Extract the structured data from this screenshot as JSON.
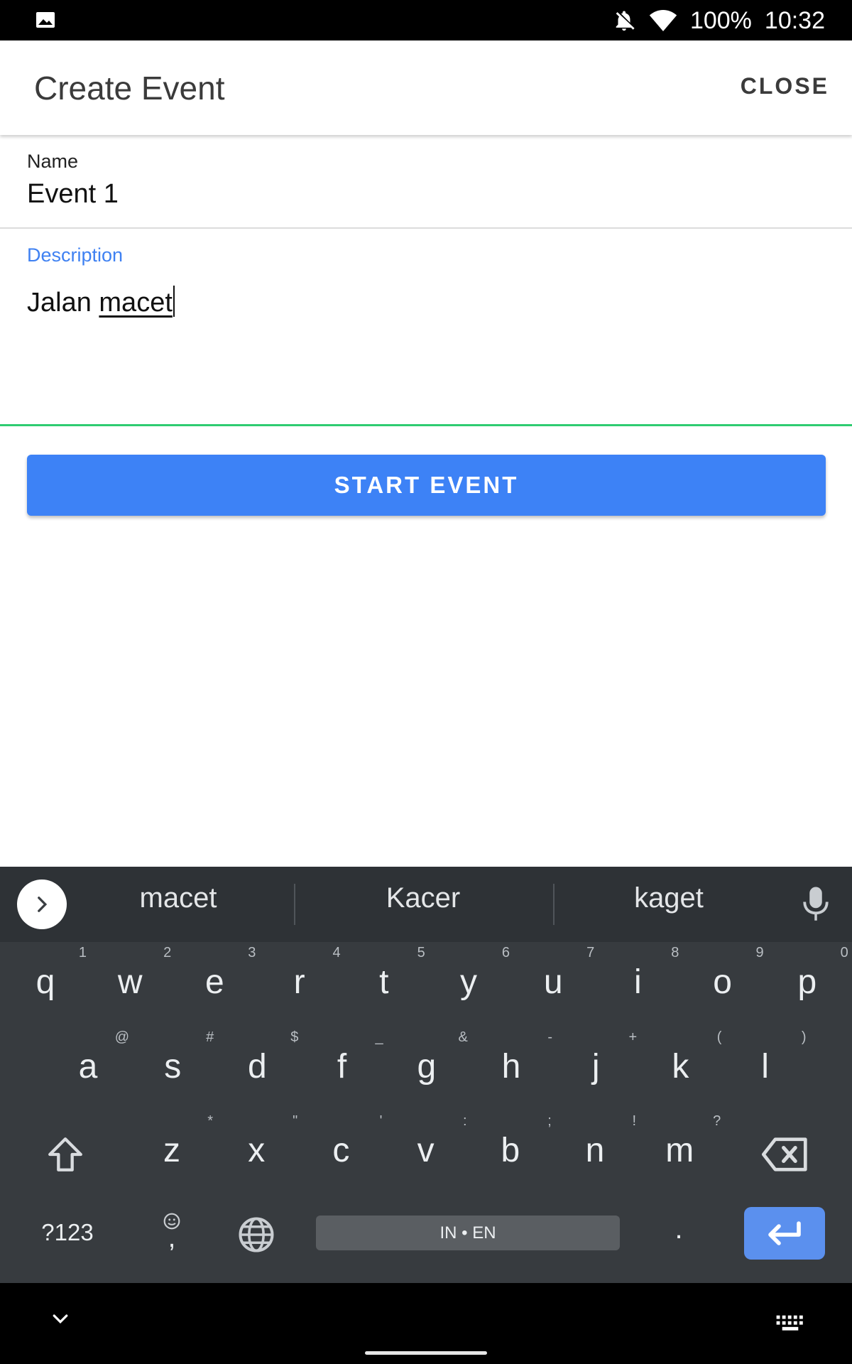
{
  "status_bar": {
    "icons": [
      "image-icon",
      "bell-off-icon",
      "wifi-icon"
    ],
    "battery": "100%",
    "time": "10:32"
  },
  "app_bar": {
    "title": "Create Event",
    "close_label": "CLOSE"
  },
  "form": {
    "name_label": "Name",
    "name_value": "Event 1",
    "description_label": "Description",
    "description_prefix": "Jalan ",
    "description_composing": "macet",
    "description_label_color": "#3f81f2",
    "focus_underline_color": "#2ecc71"
  },
  "start_button": {
    "label": "START EVENT",
    "color": "#3d82f6"
  },
  "keyboard": {
    "suggestions": [
      "macet",
      "Kacer",
      "kaget"
    ],
    "row1": [
      {
        "k": "q",
        "h": "1"
      },
      {
        "k": "w",
        "h": "2"
      },
      {
        "k": "e",
        "h": "3"
      },
      {
        "k": "r",
        "h": "4"
      },
      {
        "k": "t",
        "h": "5"
      },
      {
        "k": "y",
        "h": "6"
      },
      {
        "k": "u",
        "h": "7"
      },
      {
        "k": "i",
        "h": "8"
      },
      {
        "k": "o",
        "h": "9"
      },
      {
        "k": "p",
        "h": "0"
      }
    ],
    "row2": [
      {
        "k": "a",
        "h": "@"
      },
      {
        "k": "s",
        "h": "#"
      },
      {
        "k": "d",
        "h": "$"
      },
      {
        "k": "f",
        "h": "_"
      },
      {
        "k": "g",
        "h": "&"
      },
      {
        "k": "h",
        "h": "-"
      },
      {
        "k": "j",
        "h": "+"
      },
      {
        "k": "k",
        "h": "("
      },
      {
        "k": "l",
        "h": ")"
      }
    ],
    "row3": [
      {
        "k": "z",
        "h": "*"
      },
      {
        "k": "x",
        "h": "\""
      },
      {
        "k": "c",
        "h": "'"
      },
      {
        "k": "v",
        "h": ":"
      },
      {
        "k": "b",
        "h": ";"
      },
      {
        "k": "n",
        "h": "!"
      },
      {
        "k": "m",
        "h": "?"
      }
    ],
    "symbols_label": "?123",
    "comma_label": ",",
    "period_label": ".",
    "space_label": "IN • EN"
  }
}
